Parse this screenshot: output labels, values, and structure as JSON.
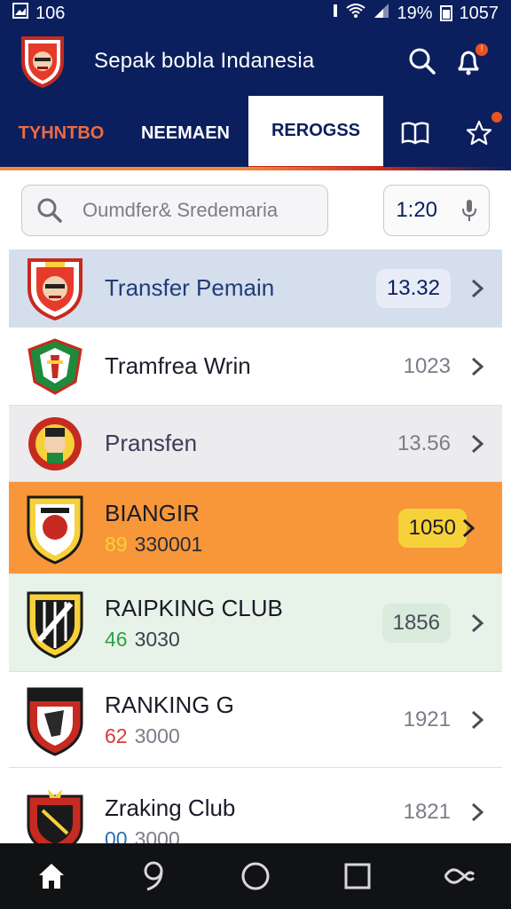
{
  "status_bar": {
    "left_text": "106",
    "battery_text": "19%",
    "time": "1057"
  },
  "app": {
    "title": "Sepak bobla Indanesia",
    "notification_badge": "!"
  },
  "tabs": [
    {
      "label": "TYHNTBO"
    },
    {
      "label": "NEEMAEN"
    },
    {
      "label": "REROGSS"
    }
  ],
  "search": {
    "placeholder": "Oumdfer& Sredemaria",
    "time_value": "1:20"
  },
  "rows": [
    {
      "name": "Transfer Pemain",
      "value": "13.32",
      "sub_num": "",
      "sub_rest": ""
    },
    {
      "name": "Tramfrea Wrin",
      "value": "1023",
      "sub_num": "",
      "sub_rest": ""
    },
    {
      "name": "Pransfen",
      "value": "13.56",
      "sub_num": "",
      "sub_rest": ""
    },
    {
      "name": "BIANGIR",
      "value": "1050",
      "sub_num": "89",
      "sub_rest": "330001"
    },
    {
      "name": "RAIPKING CLUB",
      "value": "1856",
      "sub_num": "46",
      "sub_rest": "3030"
    },
    {
      "name": "RANKING G",
      "value": "1921",
      "sub_num": "62",
      "sub_rest": "3000"
    },
    {
      "name": "Zraking Club",
      "value": "1821",
      "sub_num": "00",
      "sub_rest": "3000"
    }
  ],
  "colors": {
    "navy": "#0b1f5e",
    "orange_accent": "#f7973a",
    "yellow_pill": "#f7d13a",
    "green_num": "#2ea043",
    "red_num": "#d63a3a",
    "blue_num": "#2b6fb0",
    "yellow_num": "#f7d13a"
  },
  "icons": {
    "status_left": "gallery-icon",
    "app_search": "search-icon",
    "app_notification": "notification-icon",
    "tab_book": "book-icon",
    "tab_star": "star-icon",
    "search_field": "search-icon",
    "time_field": "microphone-icon",
    "row_chevron": "chevron-right-icon",
    "nav_home": "home-icon",
    "nav_assistant": "assistant-icon",
    "nav_circle": "circle-icon",
    "nav_square": "recent-apps-icon",
    "nav_back": "back-icon"
  }
}
